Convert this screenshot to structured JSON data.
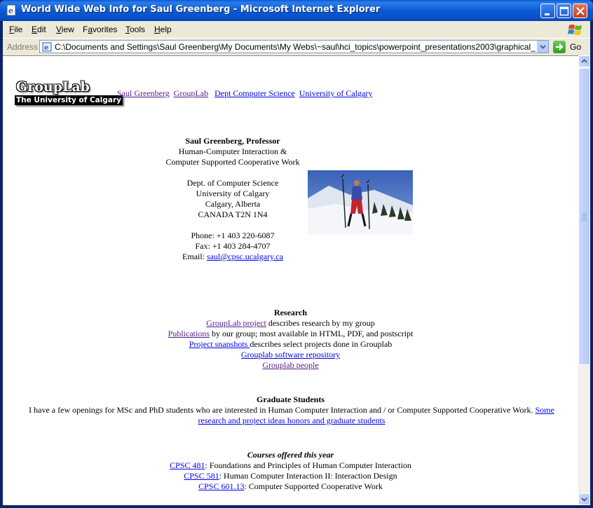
{
  "window": {
    "title": "World Wide Web Info for Saul Greenberg - Microsoft Internet Explorer"
  },
  "menubar": {
    "items": [
      {
        "key": "F",
        "rest": "ile"
      },
      {
        "key": "E",
        "rest": "dit"
      },
      {
        "key": "V",
        "rest": "iew"
      },
      {
        "key": "",
        "pre": "F",
        "key2": "a",
        "rest": "vorites"
      },
      {
        "key": "T",
        "rest": "ools"
      },
      {
        "key": "H",
        "rest": "elp"
      }
    ]
  },
  "addressbar": {
    "label": "Address",
    "value": "C:\\Documents and Settings\\Saul Greenberg\\My Documents\\My Webs\\~saul\\hci_topics\\powerpoint_presentations2003\\graphical_design\\version",
    "go_label": "Go"
  },
  "page": {
    "logo": {
      "main": "GroupLab",
      "sub": "The University of Calgary"
    },
    "top_links": [
      "Saul Greenberg",
      "GroupLab",
      "Dept Computer Science",
      "University of Calgary"
    ],
    "contact": {
      "name": "Saul Greenberg, Professor",
      "line1": "Human-Computer Interaction &",
      "line2": "Computer Supported Cooperative Work",
      "dept": "Dept. of Computer Science",
      "univ": "University of Calgary",
      "city": "Calgary, Alberta",
      "country": "CANADA T2N 1N4",
      "phone": "Phone: +1 403 220-6087",
      "fax": "Fax: +1 403 284-4707",
      "email_label": "Email: ",
      "email": "saul@cpsc.ucalgary.ca"
    },
    "research": {
      "heading": "Research",
      "items": [
        {
          "link": "GroupLab project",
          "text": " describes research by my group"
        },
        {
          "link": "Publications",
          "text": " by our group; most available in HTML, PDF, and postscript"
        },
        {
          "link": "Project snapshots ",
          "text": "describes select projects done in Grouplab"
        },
        {
          "link": "Grouplab software repository",
          "text": ""
        },
        {
          "link": "Grouplab people",
          "text": ""
        }
      ]
    },
    "grad": {
      "heading": "Graduate Students",
      "text": "I have a few openings for MSc and PhD students who are interested in Human Computer Interaction and / or Computer Supported Cooperative Work.  ",
      "link1": "Some",
      "link2": "research and project ideas honors and graduate students"
    },
    "courses": {
      "heading": "Courses offered this year",
      "items": [
        {
          "link": "CPSC 481",
          "text": ": Foundations and Principles of Human Computer Interaction"
        },
        {
          "link": "CPSC 581",
          "text": ": Human Computer Interaction II: Interaction Design"
        },
        {
          "link": "CPSC 601.13",
          "text": ": Computer Supported Cooperative Work"
        }
      ]
    }
  }
}
